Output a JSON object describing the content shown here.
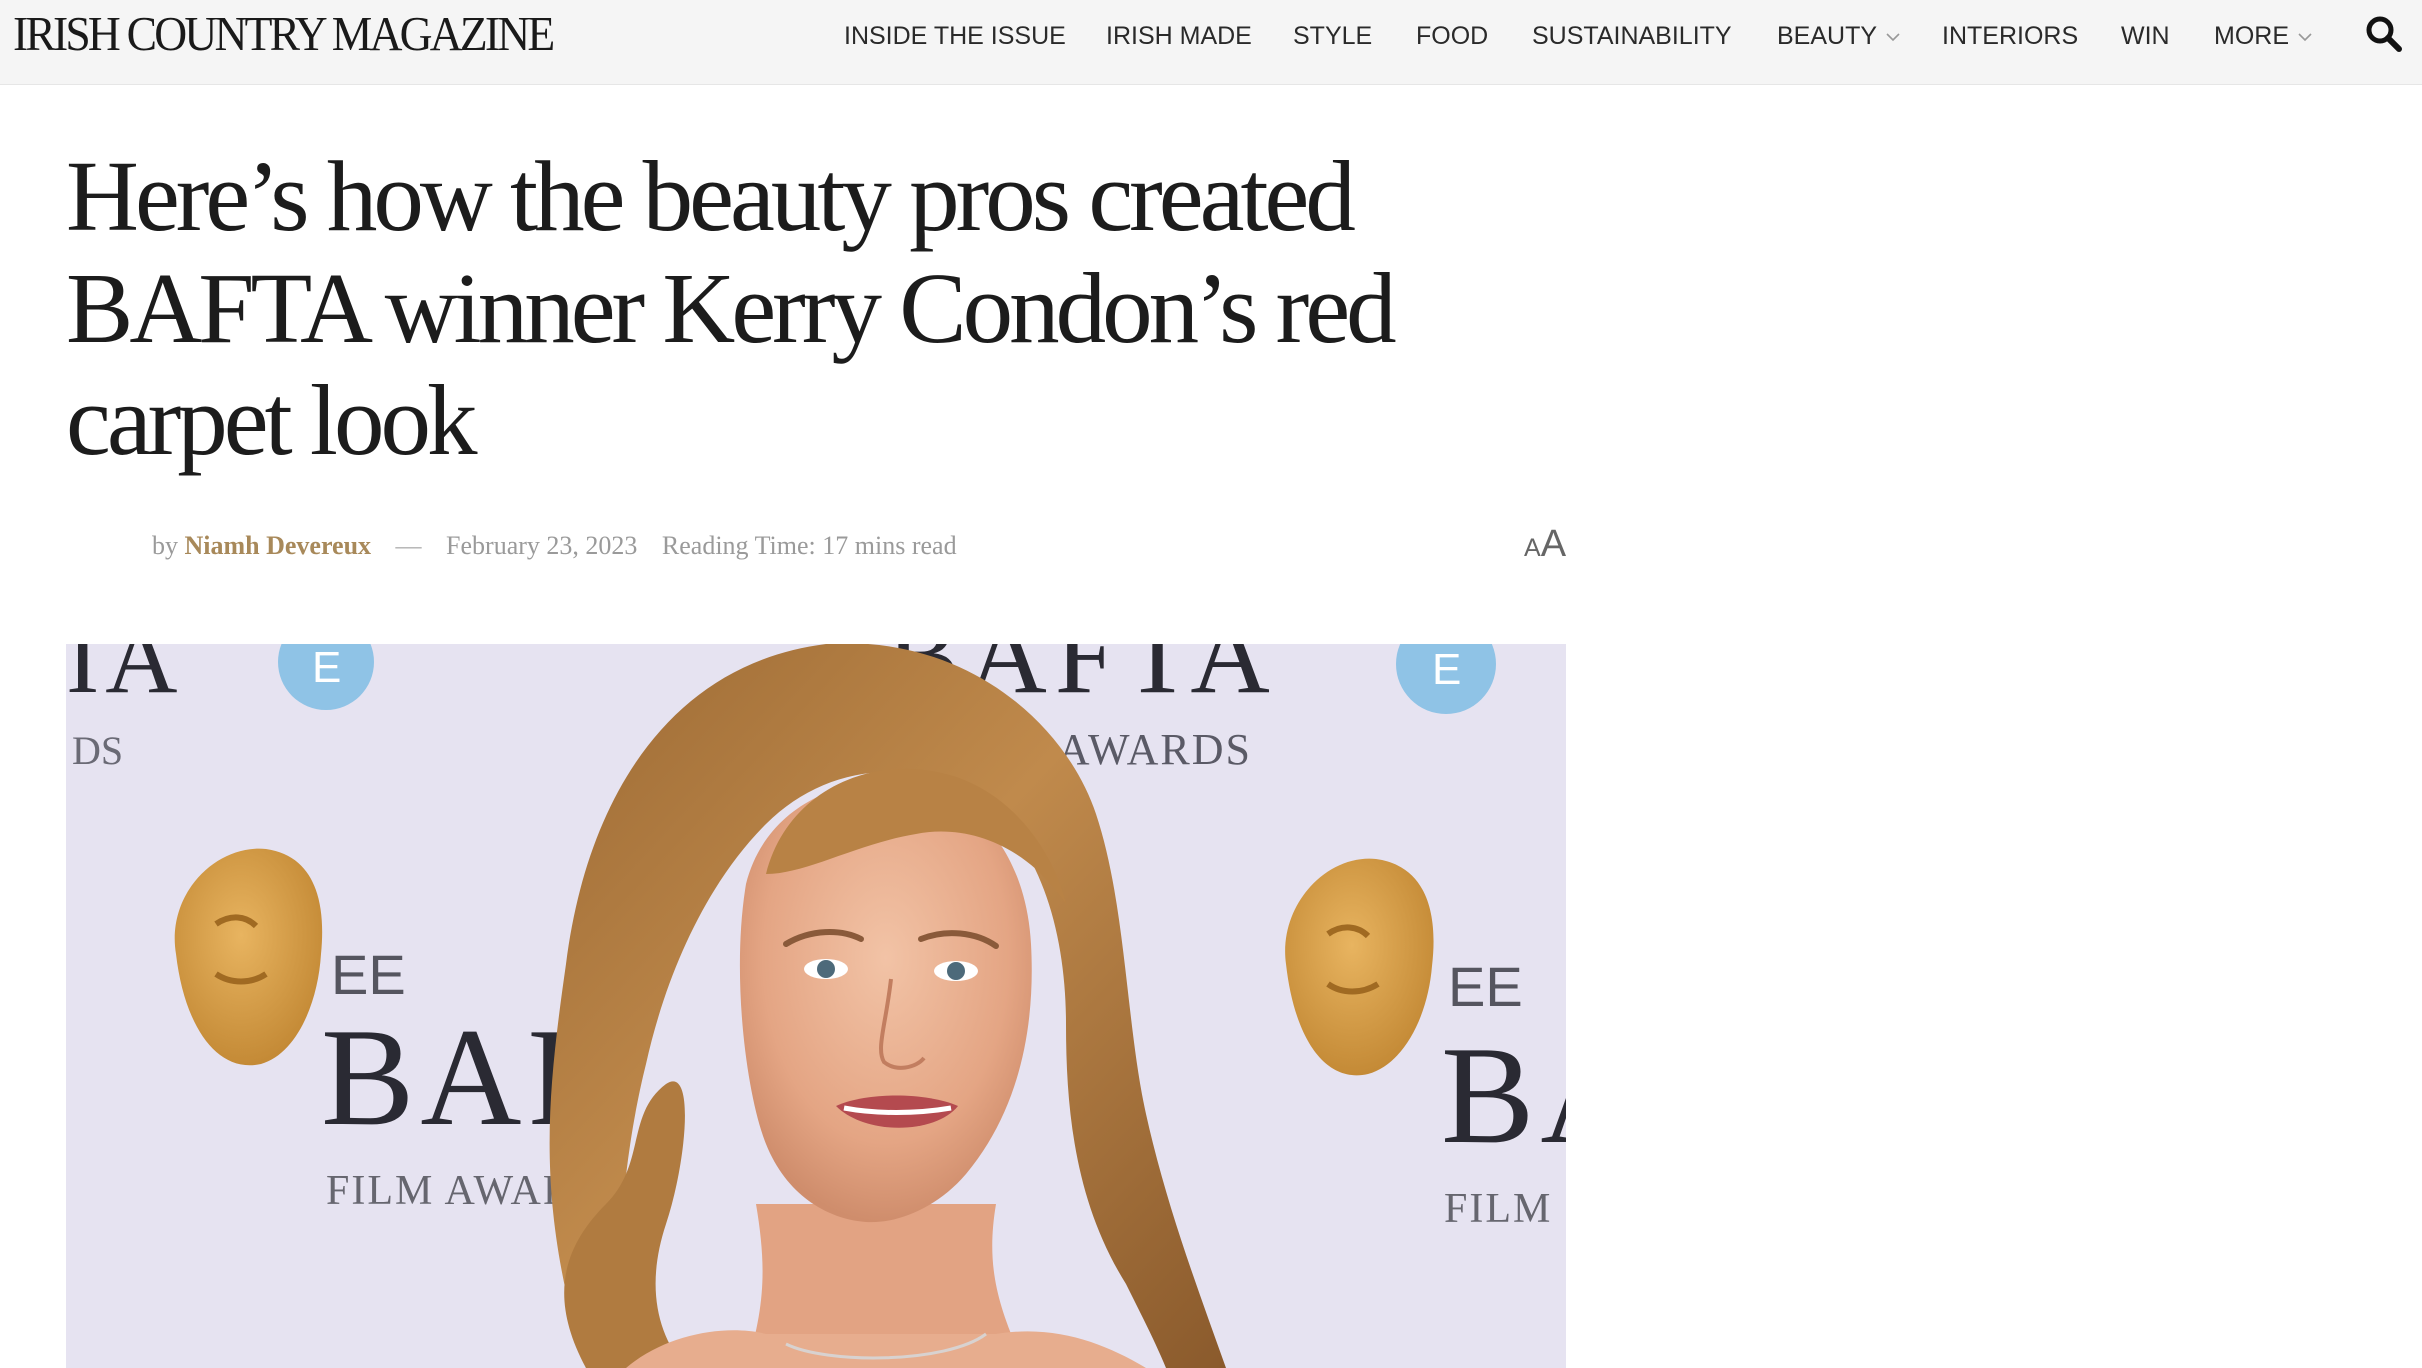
{
  "site": {
    "logo": "Irish Country Magazine"
  },
  "nav": {
    "items": [
      {
        "label": "INSIDE THE ISSUE"
      },
      {
        "label": "IRISH MADE"
      },
      {
        "label": "STYLE"
      },
      {
        "label": "FOOD"
      },
      {
        "label": "SUSTAINABILITY"
      },
      {
        "label": "BEAUTY",
        "has_dropdown": true
      },
      {
        "label": "INTERIORS"
      },
      {
        "label": "WIN"
      },
      {
        "label": "MORE",
        "has_dropdown": true
      }
    ],
    "search_icon": "search-icon",
    "dropdown_icon": "chevron-down-icon"
  },
  "article": {
    "title": "Here’s how the beauty pros created BAFTA winner Kerry Condon’s red carpet look",
    "byline_prefix": "by",
    "author": "Niamh Devereux",
    "dash": "—",
    "date": "February 23, 2023",
    "reading_time": "Reading Time: 17 mins read",
    "font_toggle_small": "A",
    "font_toggle_large": "A"
  },
  "featured_image": {
    "backdrop_text": {
      "top_left_fragment": "IA",
      "top_left_sub": "DS",
      "top_center": "BAFTA",
      "top_center_sub": "M AWARDS",
      "logo_badge": "E",
      "left_ee": "EE",
      "left_bafta": "BAF",
      "left_film": "FILM AWAR",
      "right_ee": "EE",
      "right_bafta": "BA",
      "right_film": "FILM"
    }
  },
  "colors": {
    "header_bg": "#f5f5f5",
    "author_link": "#a8895a",
    "meta_text": "#9a9a9a",
    "backdrop": "#e6e3f1",
    "badge_blue": "#8fc3e6",
    "mask_gold": "#d4a04a"
  }
}
